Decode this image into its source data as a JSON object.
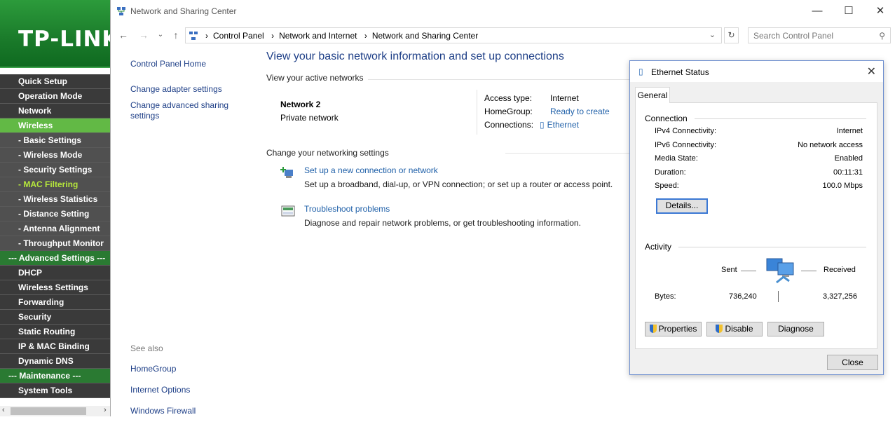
{
  "tplink": {
    "logo": "TP-LINK",
    "menu": [
      {
        "label": "Quick Setup",
        "kind": "top"
      },
      {
        "label": "Operation Mode",
        "kind": "top"
      },
      {
        "label": "Network",
        "kind": "top"
      },
      {
        "label": "Wireless",
        "kind": "act"
      },
      {
        "label": "- Basic Settings",
        "kind": "sub"
      },
      {
        "label": "- Wireless Mode",
        "kind": "sub"
      },
      {
        "label": "- Security Settings",
        "kind": "sub"
      },
      {
        "label": "- MAC Filtering",
        "kind": "sel"
      },
      {
        "label": "- Wireless Statistics",
        "kind": "sub"
      },
      {
        "label": "- Distance Setting",
        "kind": "sub"
      },
      {
        "label": "- Antenna Alignment",
        "kind": "sub"
      },
      {
        "label": "- Throughput Monitor",
        "kind": "sub"
      },
      {
        "label": "--- Advanced Settings ---",
        "kind": "sec"
      },
      {
        "label": "DHCP",
        "kind": "top"
      },
      {
        "label": "Wireless Settings",
        "kind": "top"
      },
      {
        "label": "Forwarding",
        "kind": "top"
      },
      {
        "label": "Security",
        "kind": "top"
      },
      {
        "label": "Static Routing",
        "kind": "top"
      },
      {
        "label": "IP & MAC Binding",
        "kind": "top"
      },
      {
        "label": "Dynamic DNS",
        "kind": "top"
      },
      {
        "label": "--- Maintenance ---",
        "kind": "sec"
      },
      {
        "label": "System Tools",
        "kind": "top"
      }
    ]
  },
  "window": {
    "title": "Network and Sharing Center",
    "breadcrumbs": [
      "Control Panel",
      "Network and Internet",
      "Network and Sharing Center"
    ],
    "search_placeholder": "Search Control Panel"
  },
  "left": {
    "home": "Control Panel Home",
    "adapter": "Change adapter settings",
    "sharing": "Change advanced sharing settings",
    "see_also": "See also",
    "homegroup": "HomeGroup",
    "internet_options": "Internet Options",
    "firewall": "Windows Firewall"
  },
  "main": {
    "heading": "View your basic network information and set up connections",
    "active_networks": "View your active networks",
    "network_name": "Network  2",
    "network_type": "Private network",
    "access_type_label": "Access type:",
    "access_type_value": "Internet",
    "homegroup_label": "HomeGroup:",
    "homegroup_value": "Ready to create",
    "connections_label": "Connections:",
    "connections_value": "Ethernet",
    "change_settings": "Change your networking settings",
    "task1_title": "Set up a new connection or network",
    "task1_desc": "Set up a broadband, dial-up, or VPN connection; or set up a router or access point.",
    "task2_title": "Troubleshoot problems",
    "task2_desc": "Diagnose and repair network problems, or get troubleshooting information."
  },
  "eth": {
    "title": "Ethernet Status",
    "tab": "General",
    "connection": "Connection",
    "rows": [
      {
        "k": "IPv4 Connectivity:",
        "v": "Internet"
      },
      {
        "k": "IPv6 Connectivity:",
        "v": "No network access"
      },
      {
        "k": "Media State:",
        "v": "Enabled"
      },
      {
        "k": "Duration:",
        "v": "00:11:31"
      },
      {
        "k": "Speed:",
        "v": "100.0 Mbps"
      }
    ],
    "details": "Details...",
    "activity": "Activity",
    "sent": "Sent",
    "received": "Received",
    "bytes_label": "Bytes:",
    "bytes_sent": "736,240",
    "bytes_received": "3,327,256",
    "properties": "Properties",
    "disable": "Disable",
    "diagnose": "Diagnose",
    "close": "Close"
  }
}
